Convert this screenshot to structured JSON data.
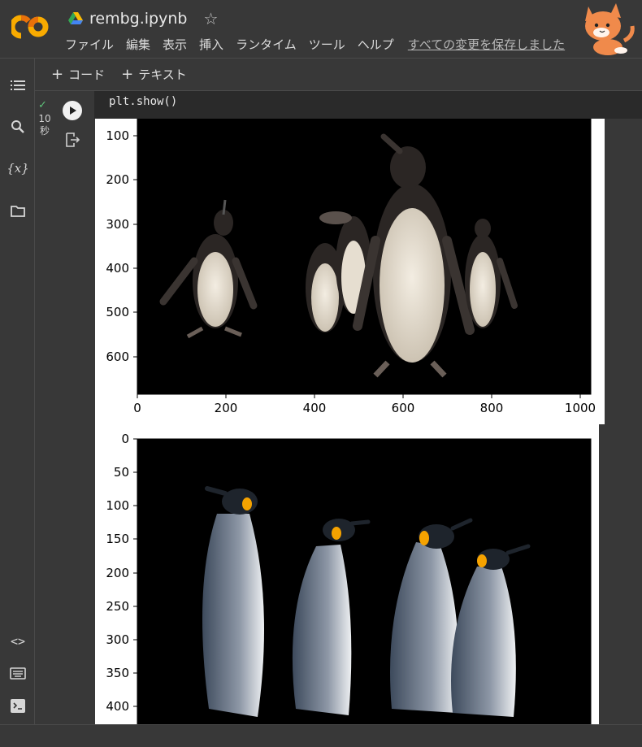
{
  "header": {
    "logo_text": "CO",
    "title": "rembg.ipynb",
    "star": "☆",
    "menu": [
      "ファイル",
      "編集",
      "表示",
      "挿入",
      "ランタイム",
      "ツール",
      "ヘルプ"
    ],
    "saved_status": "すべての変更を保存しました"
  },
  "toolbar": {
    "add_code_label": "コード",
    "add_text_label": "テキスト"
  },
  "cell": {
    "exec_time": "10",
    "exec_unit": "秒",
    "code": "plt.show()"
  },
  "chart_data": [
    {
      "type": "image",
      "x_ticks": [
        0,
        200,
        400,
        600,
        800,
        1000
      ],
      "y_ticks": [
        100,
        200,
        300,
        400,
        500,
        600
      ],
      "xlim": [
        0,
        1024
      ],
      "ylim": [
        683,
        40
      ],
      "content": "penguins on black background"
    },
    {
      "type": "image",
      "y_ticks": [
        0,
        50,
        100,
        150,
        200,
        250,
        300,
        350,
        400
      ],
      "ylim": [
        0,
        425
      ],
      "content": "king penguins on black background"
    }
  ],
  "colors": {
    "background": "#383838",
    "logo_orange": "#f9ab00",
    "logo_dark_orange": "#e8710a",
    "check_green": "#5ec27a"
  }
}
